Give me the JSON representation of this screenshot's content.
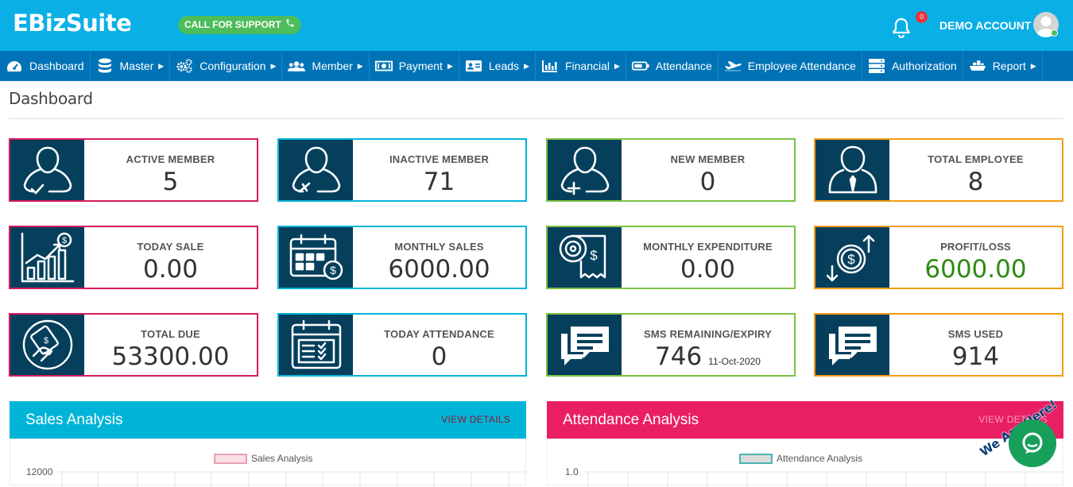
{
  "brand": {
    "logo_text": "EBizSuite"
  },
  "header": {
    "support_label": "CALL FOR SUPPORT",
    "notification_count": "0",
    "account_label": "DEMO ACCOUNT",
    "accent_color": "#0aafe6"
  },
  "nav": {
    "items": [
      {
        "label": "Dashboard",
        "icon": "dashboard-icon",
        "has_caret": false
      },
      {
        "label": "Master",
        "icon": "database-icon",
        "has_caret": true
      },
      {
        "label": "Configuration",
        "icon": "gears-icon",
        "has_caret": true
      },
      {
        "label": "Member",
        "icon": "users-icon",
        "has_caret": true
      },
      {
        "label": "Payment",
        "icon": "money-icon",
        "has_caret": true
      },
      {
        "label": "Leads",
        "icon": "id-card-icon",
        "has_caret": true
      },
      {
        "label": "Financial",
        "icon": "bar-chart-icon",
        "has_caret": true
      },
      {
        "label": "Attendance",
        "icon": "battery-icon",
        "has_caret": false
      },
      {
        "label": "Employee Attendance",
        "icon": "plane-icon",
        "has_caret": false
      },
      {
        "label": "Authorization",
        "icon": "server-icon",
        "has_caret": false
      },
      {
        "label": "Report",
        "icon": "ship-icon",
        "has_caret": true
      }
    ]
  },
  "page": {
    "title": "Dashboard"
  },
  "cards": [
    {
      "label": "ACTIVE MEMBER",
      "value": "5",
      "icon": "user-check-icon",
      "border": "#d81b60"
    },
    {
      "label": "INACTIVE MEMBER",
      "value": "71",
      "icon": "user-remove-icon",
      "border": "#00b4d8"
    },
    {
      "label": "NEW MEMBER",
      "value": "0",
      "icon": "user-add-icon",
      "border": "#7cc242"
    },
    {
      "label": "TOTAL EMPLOYEE",
      "value": "8",
      "icon": "employee-icon",
      "border": "#f39c12"
    },
    {
      "label": "TODAY SALE",
      "value": "0.00",
      "icon": "growth-chart-icon",
      "border": "#d81b60"
    },
    {
      "label": "MONTHLY SALES",
      "value": "6000.00",
      "icon": "calendar-dollar-icon",
      "border": "#00b4d8"
    },
    {
      "label": "MONTHLY EXPENDITURE",
      "value": "0.00",
      "icon": "receipt-roll-icon",
      "border": "#7cc242"
    },
    {
      "label": "PROFIT/LOSS",
      "value": "6000.00",
      "icon": "dollar-arrows-icon",
      "border": "#f39c12",
      "value_color": "#2e8b13"
    },
    {
      "label": "TOTAL DUE",
      "value": "53300.00",
      "icon": "hand-money-icon",
      "border": "#d81b60"
    },
    {
      "label": "TODAY ATTENDANCE",
      "value": "0",
      "icon": "calendar-checklist-icon",
      "border": "#00b4d8"
    },
    {
      "label": "SMS REMAINING/EXPIRY",
      "value": "746",
      "sub": "11-Oct-2020",
      "icon": "chat-bubble-icon",
      "border": "#7cc242"
    },
    {
      "label": "SMS USED",
      "value": "914",
      "icon": "chat-bubble-icon",
      "border": "#f39c12"
    }
  ],
  "sales_panel": {
    "title": "Sales Analysis",
    "view_details": "VIEW DETAILS",
    "color": "#00b4d8",
    "legend": "Sales Analysis",
    "ytick_top": "12000"
  },
  "attendance_panel": {
    "title": "Attendance Analysis",
    "view_details": "VIEW DETAILS",
    "color": "#e91e63",
    "legend": "Attendance Analysis",
    "ytick_top": "1.0"
  },
  "chat_widget": {
    "bubble_text": "We Are Here!"
  }
}
